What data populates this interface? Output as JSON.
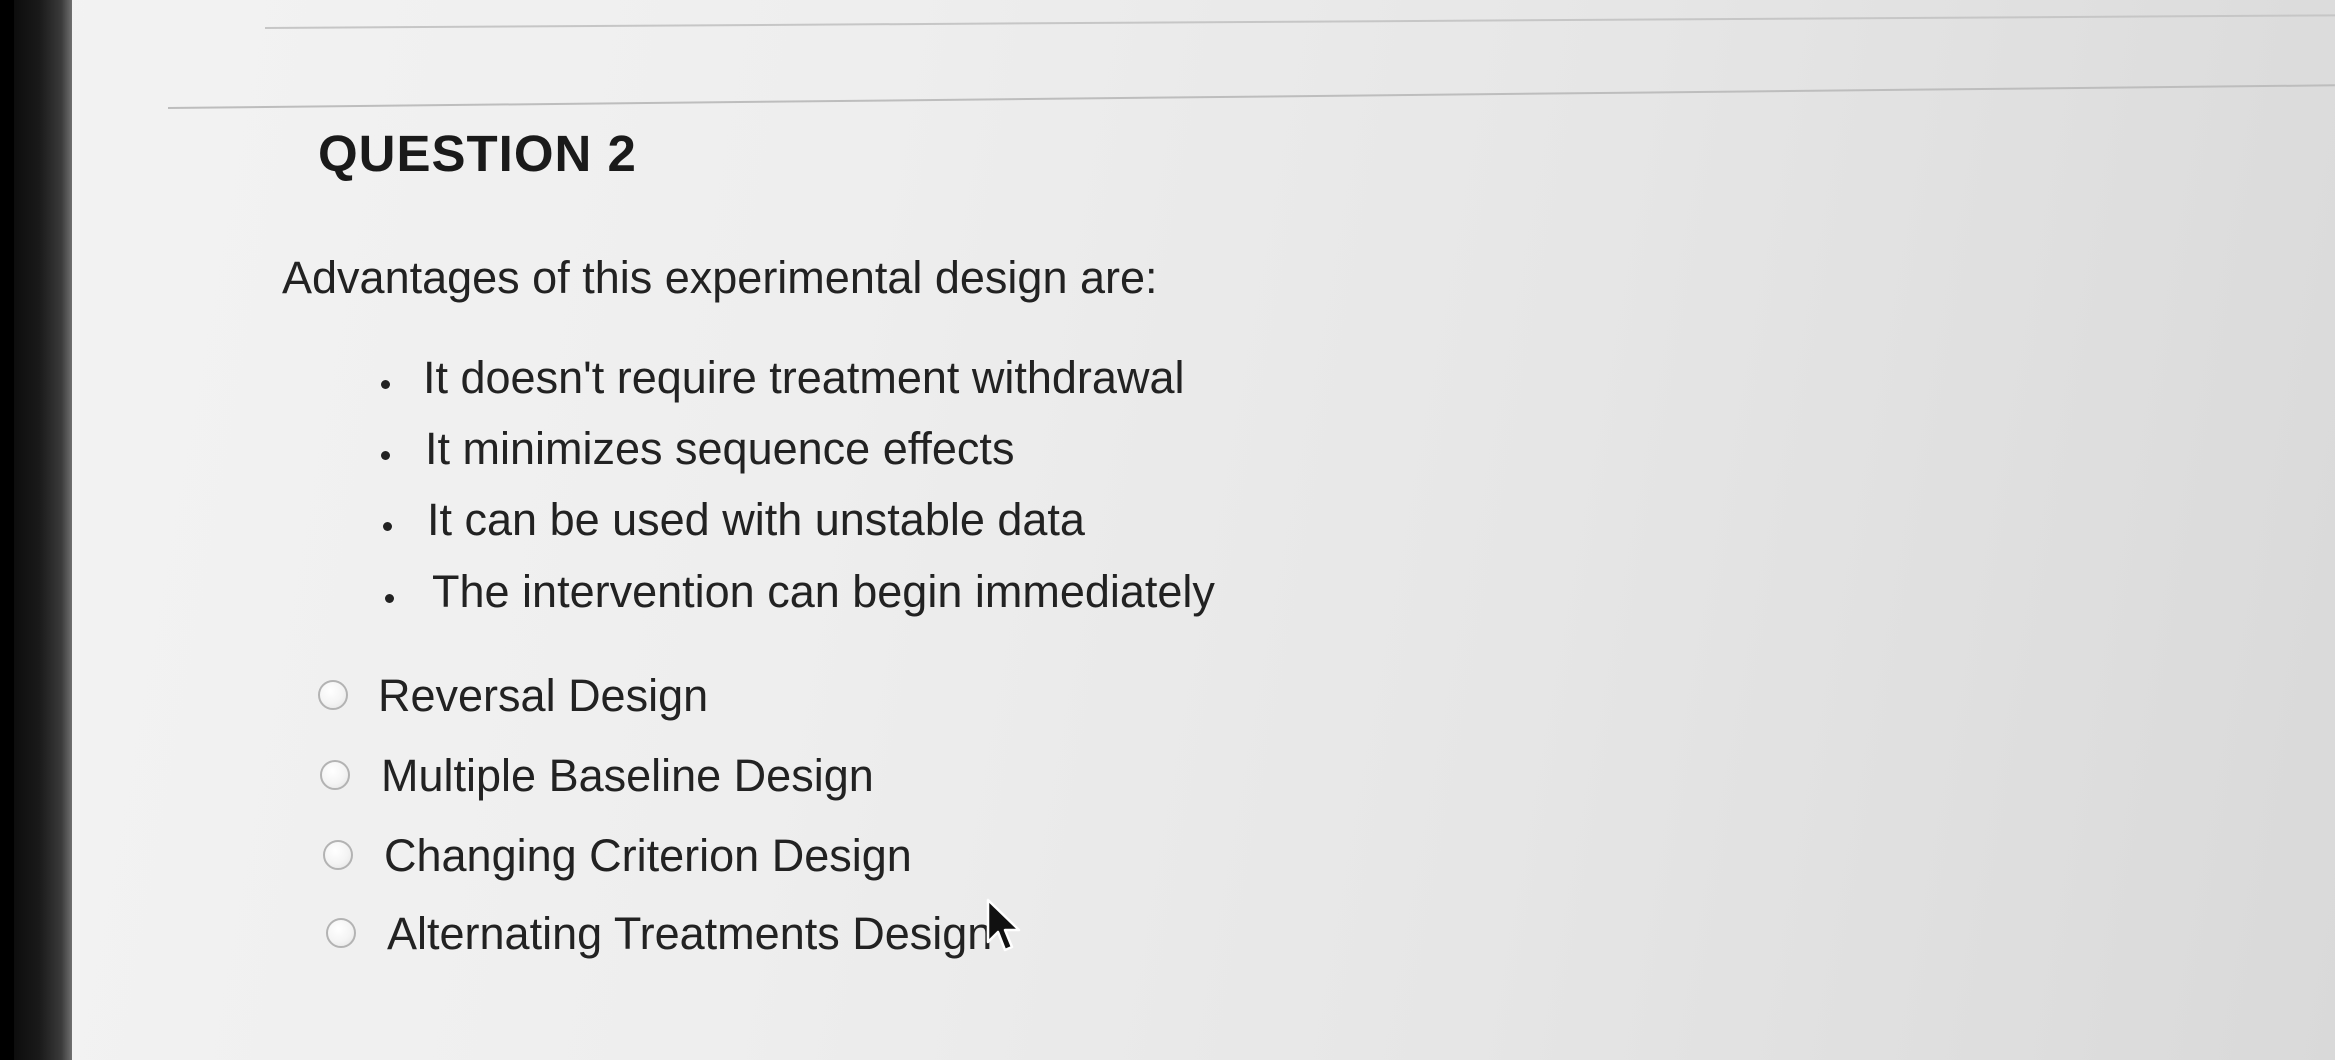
{
  "question": {
    "title": "QUESTION 2",
    "prompt": "Advantages of this experimental design are:",
    "bullets": [
      "It doesn't require treatment withdrawal",
      "It minimizes sequence effects",
      "It can be used with unstable data",
      "The intervention can begin immediately"
    ],
    "options": [
      {
        "label": "Reversal Design",
        "selected": false
      },
      {
        "label": "Multiple Baseline Design",
        "selected": false
      },
      {
        "label": "Changing Criterion Design",
        "selected": false
      },
      {
        "label": "Alternating Treatments Design",
        "selected": false
      }
    ]
  },
  "icons": {
    "cursor": "mouse-pointer-arrow-icon",
    "radio": "radio-button-icon"
  },
  "colors": {
    "text": "#222222",
    "rule": "#c0c0c0",
    "radio_border": "#b3b3b3"
  }
}
